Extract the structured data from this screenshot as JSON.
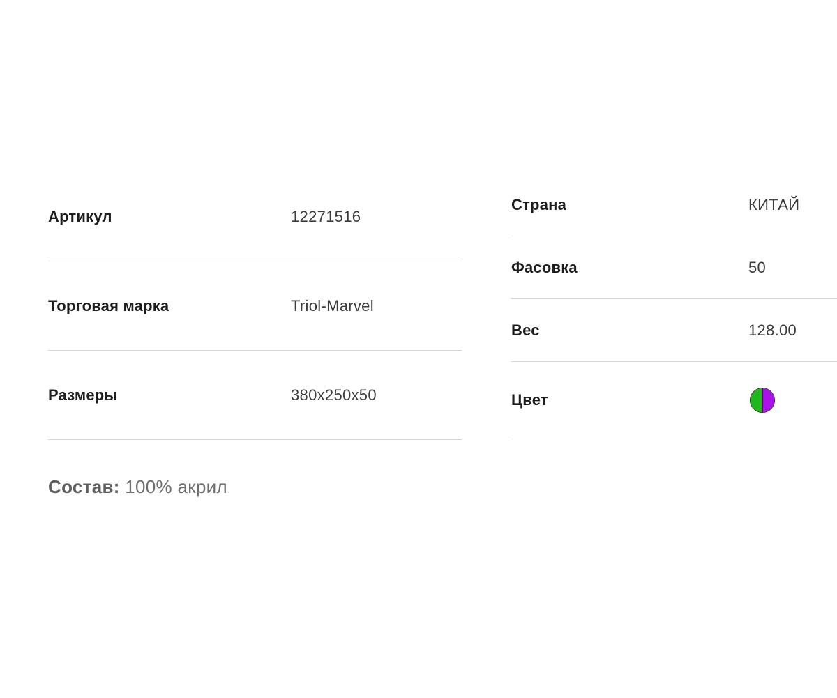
{
  "left_specs": [
    {
      "label": "Артикул",
      "value": "12271516"
    },
    {
      "label": "Торговая марка",
      "value": "Triol-Marvel"
    },
    {
      "label": "Размеры",
      "value": "380x250x50"
    }
  ],
  "right_specs": [
    {
      "label": "Страна",
      "value": "КИТАЙ"
    },
    {
      "label": "Фасовка",
      "value": "50"
    },
    {
      "label": "Вес",
      "value": "128.00"
    }
  ],
  "color_spec": {
    "label": "Цвет",
    "swatch_colors": [
      "#1fb81c",
      "#a913e8"
    ],
    "swatch_border": "#2a2a2a"
  },
  "composition": {
    "label": "Состав:",
    "value": "100% акрил"
  }
}
